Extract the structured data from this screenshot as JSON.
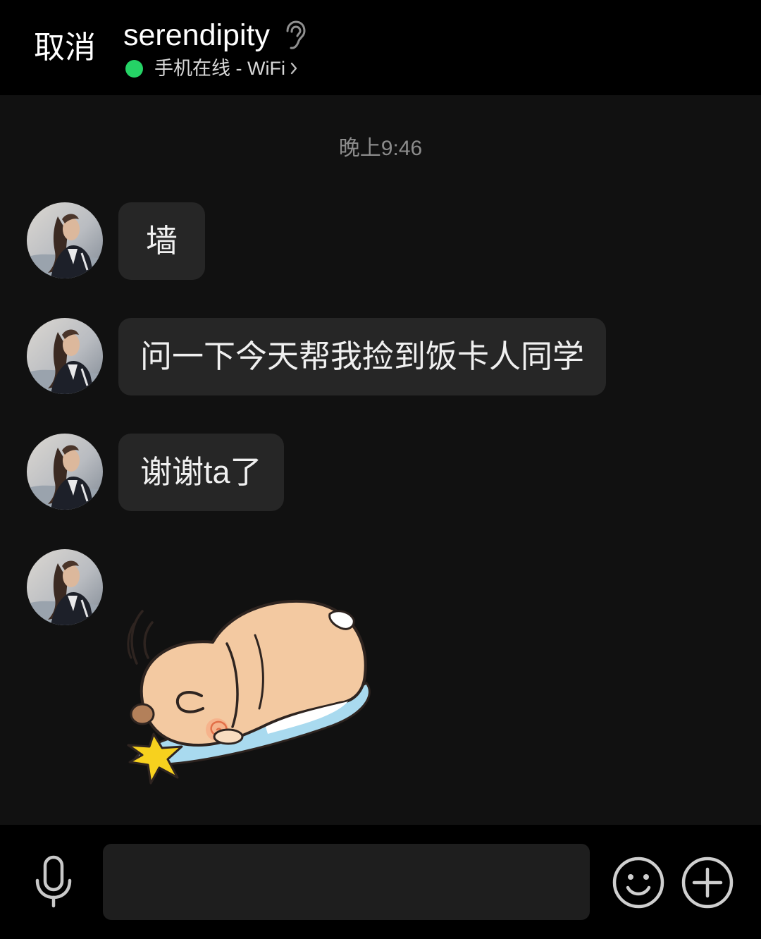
{
  "header": {
    "cancel_label": "取消",
    "contact_name": "serendipity",
    "status_text": "手机在线 - WiFi",
    "icons": {
      "earpiece": "ear-icon",
      "status_arrow": "chevron-right-icon",
      "online_indicator": "online-dot-icon"
    }
  },
  "chat": {
    "timestamp": "晚上9:46",
    "messages": [
      {
        "text": "墙"
      },
      {
        "text": "问一下今天帮我捡到饭卡人同学"
      },
      {
        "text": "谢谢ta了"
      }
    ],
    "sticker_icon": "sleeping-hamster-sticker",
    "avatar_icon": "contact-avatar"
  },
  "input_bar": {
    "input_value": "",
    "icons": {
      "voice": "microphone-icon",
      "emoji": "smiley-icon",
      "more": "plus-icon"
    }
  },
  "colors": {
    "header_bg": "#000000",
    "chat_bg": "#111111",
    "bubble_bg": "#262626",
    "bar_bg": "#000000",
    "input_bg": "#1e1e1e",
    "online": "#25d366",
    "timestamp": "#8c8c8c"
  }
}
